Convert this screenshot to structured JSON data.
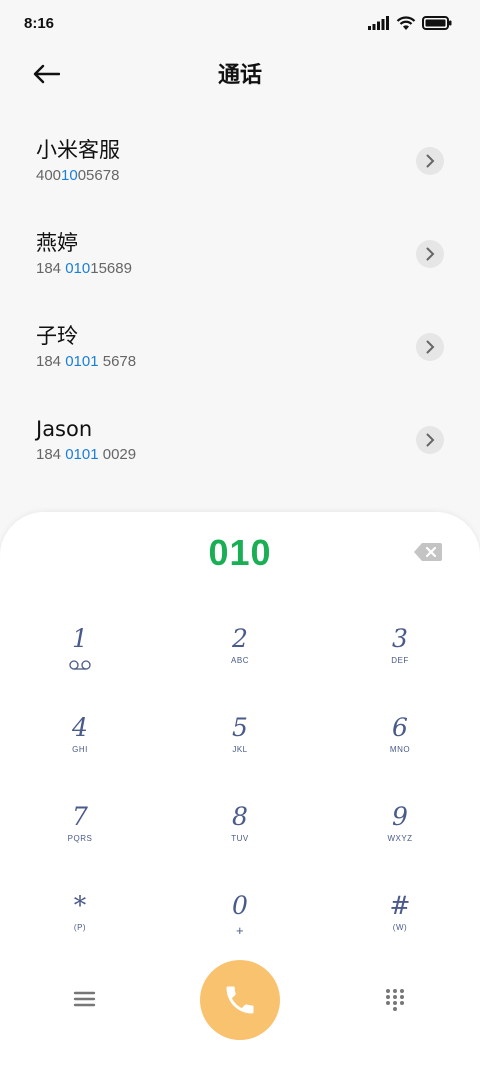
{
  "status": {
    "time": "8:16"
  },
  "header": {
    "title": "通话"
  },
  "contacts": [
    {
      "name": "小米客服",
      "number_pre": "400",
      "number_hl": "10",
      "number_post": "05678"
    },
    {
      "name": "燕婷",
      "number_pre": "184 ",
      "number_hl": "010",
      "number_post": "15689"
    },
    {
      "name": "子玲",
      "number_pre": "184 ",
      "number_hl": "0101",
      "number_post": " 5678"
    },
    {
      "name": "Jason",
      "number_pre": "184 ",
      "number_hl": "0101",
      "number_post": " 0029"
    }
  ],
  "dialpad": {
    "dialed": "010",
    "keys": [
      {
        "digit": "1",
        "letters": ""
      },
      {
        "digit": "2",
        "letters": "ABC"
      },
      {
        "digit": "3",
        "letters": "DEF"
      },
      {
        "digit": "4",
        "letters": "GHI"
      },
      {
        "digit": "5",
        "letters": "JKL"
      },
      {
        "digit": "6",
        "letters": "MNO"
      },
      {
        "digit": "7",
        "letters": "PQRS"
      },
      {
        "digit": "8",
        "letters": "TUV"
      },
      {
        "digit": "9",
        "letters": "WXYZ"
      },
      {
        "digit": "*",
        "letters": "(P)"
      },
      {
        "digit": "0",
        "letters": "+"
      },
      {
        "digit": "#",
        "letters": "(W)"
      }
    ]
  },
  "colors": {
    "highlight": "#1a7fd8",
    "dialed": "#1aaf55",
    "call_button": "#f9c26f",
    "key_text": "#4a5a8a"
  },
  "icons": {
    "back": "arrow-left-icon",
    "arrow": "chevron-right-icon",
    "backspace": "backspace-icon",
    "voicemail": "voicemail-icon",
    "menu": "menu-icon",
    "call": "phone-icon",
    "keypad": "keypad-icon"
  }
}
